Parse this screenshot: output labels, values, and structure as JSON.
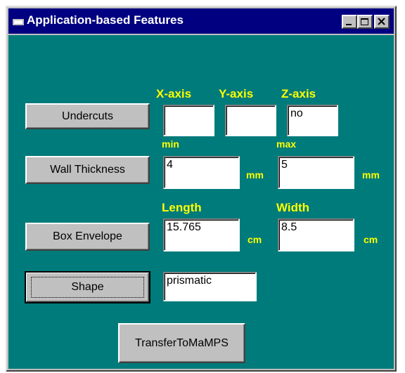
{
  "window": {
    "title": "Application-based Features",
    "title_icon": "app-window-icon",
    "controls": [
      "minimize-icon",
      "maximize-icon",
      "close-icon"
    ]
  },
  "colors": {
    "title_bar": "#000080",
    "client_bg": "#007b7b",
    "label_text": "#ffff00",
    "button_face": "#c0c0c0"
  },
  "axis_headers": {
    "x": "X-axis",
    "y": "Y-axis",
    "z": "Z-axis"
  },
  "undercuts": {
    "button": "Undercuts",
    "x_value": "",
    "y_value": "",
    "z_value": "no"
  },
  "wall_thickness": {
    "button": "Wall Thickness",
    "min_label": "min",
    "max_label": "max",
    "min_value": "4",
    "max_value": "5",
    "unit": "mm"
  },
  "box_envelope": {
    "button": "Box Envelope",
    "length_label": "Length",
    "width_label": "Width",
    "length_value": "15.765",
    "width_value": "8.5",
    "unit": "cm"
  },
  "shape": {
    "button": "Shape",
    "value": "prismatic"
  },
  "transfer": {
    "button": "TransferToMaMPS"
  }
}
